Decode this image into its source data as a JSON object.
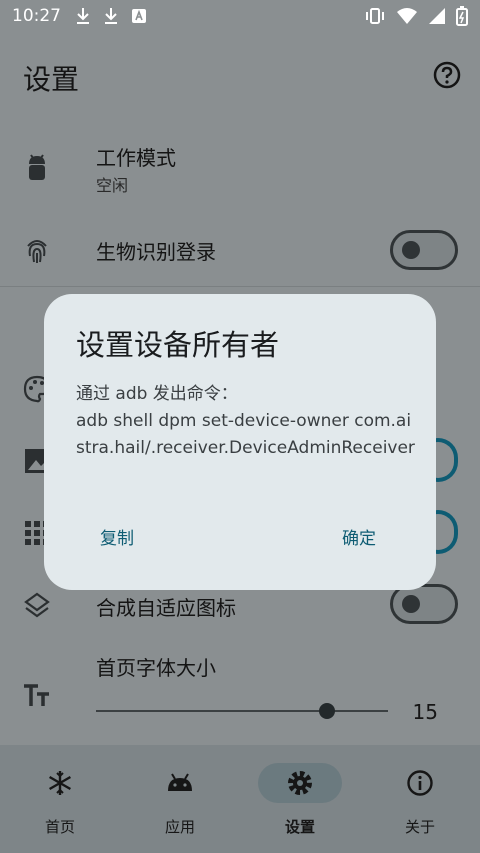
{
  "status_bar": {
    "time": "10:27"
  },
  "header": {
    "title": "设置"
  },
  "settings": {
    "work_mode": {
      "title": "工作模式",
      "value": "空闲"
    },
    "biometric": {
      "title": "生物识别登录",
      "enabled": false
    },
    "adaptive_icon": {
      "title": "合成自适应图标",
      "enabled": false
    },
    "font_size": {
      "title": "首页字体大小",
      "value": "15",
      "level_fraction": 0.79
    }
  },
  "dialog": {
    "title": "设置设备所有者",
    "body_intro": "通过 adb 发出命令：",
    "body_command": "adb shell dpm set-device-owner com.aistra.hail/.receiver.DeviceAdminReceiver",
    "copy_label": "复制",
    "confirm_label": "确定"
  },
  "bottom_nav": {
    "items": [
      {
        "label": "首页",
        "icon": "snowflake-icon"
      },
      {
        "label": "应用",
        "icon": "android-icon"
      },
      {
        "label": "设置",
        "icon": "gear-icon",
        "active": true
      },
      {
        "label": "关于",
        "icon": "info-icon"
      }
    ]
  },
  "colors": {
    "accent": "#0e5c73",
    "dialog_bg": "#e2e9ec",
    "scrim_bg": "#8a8f91"
  }
}
